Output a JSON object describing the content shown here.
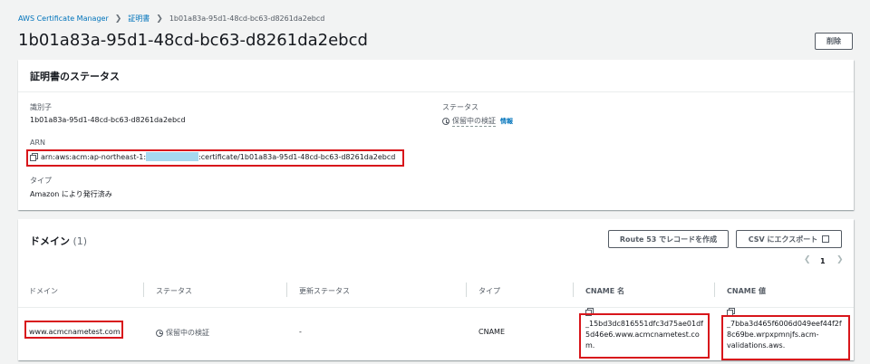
{
  "breadcrumb": {
    "service": "AWS Certificate Manager",
    "certificates": "証明書",
    "current": "1b01a83a-95d1-48cd-bc63-d8261da2ebcd"
  },
  "header": {
    "title": "1b01a83a-95d1-48cd-bc63-d8261da2ebcd",
    "delete_label": "削除"
  },
  "status_card": {
    "title": "証明書のステータス",
    "identifier_label": "識別子",
    "identifier_value": "1b01a83a-95d1-48cd-bc63-d8261da2ebcd",
    "status_label": "ステータス",
    "status_value": "保留中の検証",
    "info_link": "情報",
    "arn_label": "ARN",
    "arn_prefix": "arn:aws:acm:ap-northeast-1:",
    "arn_suffix": ":certificate/1b01a83a-95d1-48cd-bc63-d8261da2ebcd",
    "type_label": "タイプ",
    "type_value": "Amazon により発行済み"
  },
  "domain_card": {
    "title": "ドメイン",
    "count": "(1)",
    "route53_button": "Route 53 でレコードを作成",
    "csv_button": "CSV にエクスポート",
    "page_number": "1",
    "columns": [
      "ドメイン",
      "ステータス",
      "更新ステータス",
      "タイプ",
      "CNAME 名",
      "CNAME 値"
    ],
    "row": {
      "domain": "www.acmcnametest.com",
      "status": "保留中の検証",
      "renewal_status": "-",
      "type": "CNAME",
      "cname_name_lines": [
        "_15bd3dc816551dfc3d75ae01df",
        "5d46e6.www.acmcnametest.co",
        "m."
      ],
      "cname_value_lines": [
        "_7bba3d465f6006d049eef44f2f",
        "8c69be.wrpxpmnjfs.acm-",
        "validations.aws."
      ]
    }
  },
  "colors": {
    "link": "#0073bb",
    "highlight": "#d8161b",
    "redaction": "#a5d8ef"
  }
}
